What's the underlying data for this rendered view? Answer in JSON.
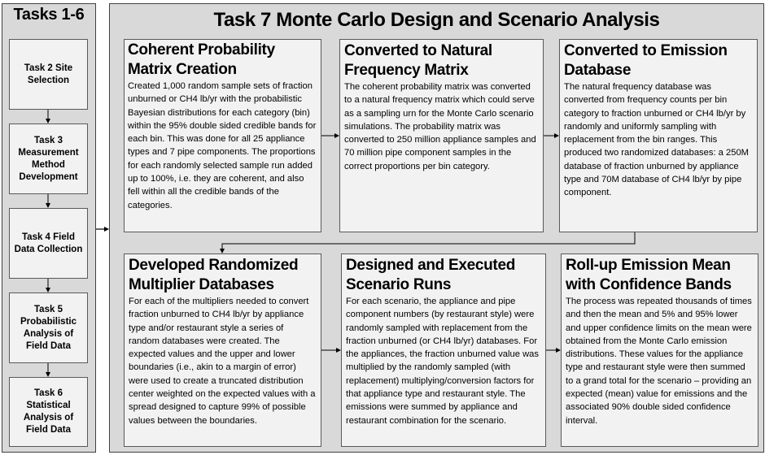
{
  "left_panel": {
    "title": "Tasks 1-6",
    "tasks": [
      {
        "label": "Task 2 Site Selection"
      },
      {
        "label": "Task 3 Measurement Method Development"
      },
      {
        "label": "Task 4 Field Data Collection"
      },
      {
        "label": "Task 5 Probabilistic Analysis of Field Data"
      },
      {
        "label": "Task 6 Statistical Analysis of Field Data"
      }
    ]
  },
  "main_panel": {
    "title": "Task 7 Monte Carlo Design and Scenario Analysis",
    "steps": [
      {
        "title": "Coherent Probability Matrix Creation",
        "body": "Created 1,000 random sample sets of fraction unburned or CH4 lb/yr with the probabilistic Bayesian distributions for each category (bin) within the 95% double sided credible bands for each bin.  This was done for all 25 appliance types and 7 pipe components.  The proportions for each randomly selected sample run added up to 100%, i.e. they are coherent, and also fell within all the credible bands of the categories."
      },
      {
        "title": "Converted to Natural Frequency Matrix",
        "body": "The coherent probability matrix was converted to a natural frequency matrix which could serve as a sampling urn for the Monte Carlo scenario simulations.  The probability matrix was converted to 250 million appliance samples and 70 million pipe component samples in the correct proportions per bin category."
      },
      {
        "title": "Converted to Emission Database",
        "body": "The natural frequency database was converted from frequency counts per bin category to fraction unburned or CH4 lb/yr by randomly and uniformly sampling with replacement from the bin ranges.  This produced two randomized databases: a 250M database of fraction unburned by appliance type and 70M database of CH4 lb/yr by pipe component."
      },
      {
        "title": "Developed Randomized Multiplier Databases",
        "body": "For each of the multipliers needed to convert fraction unburned to CH4 lb/yr by appliance type and/or restaurant style a series of random databases were created.  The expected values and the upper and lower boundaries (i.e., akin to a margin of error) were used to create a truncated distribution center weighted on the expected values with a spread designed to capture 99% of possible values between the boundaries."
      },
      {
        "title": "Designed and Executed Scenario Runs",
        "body": "For each scenario, the appliance and pipe component numbers (by restaurant style) were randomly sampled with replacement from the fraction unburned (or CH4 lb/yr) databases.  For the appliances, the fraction unburned value was multiplied by the randomly sampled (with replacement) multiplying/conversion factors for that appliance type and restaurant style.  The emissions were summed by appliance and restaurant combination for the scenario."
      },
      {
        "title": "Roll-up Emission Mean with Confidence Bands",
        "body": "The process was repeated thousands of times and then the mean and 5% and 95% lower and upper confidence limits on the mean were obtained from the Monte Carlo emission distributions.  These values for the appliance type and restaurant style were then summed to a grand total for the scenario – providing an expected (mean) value for emissions and the associated 90% double sided confidence interval."
      }
    ]
  }
}
